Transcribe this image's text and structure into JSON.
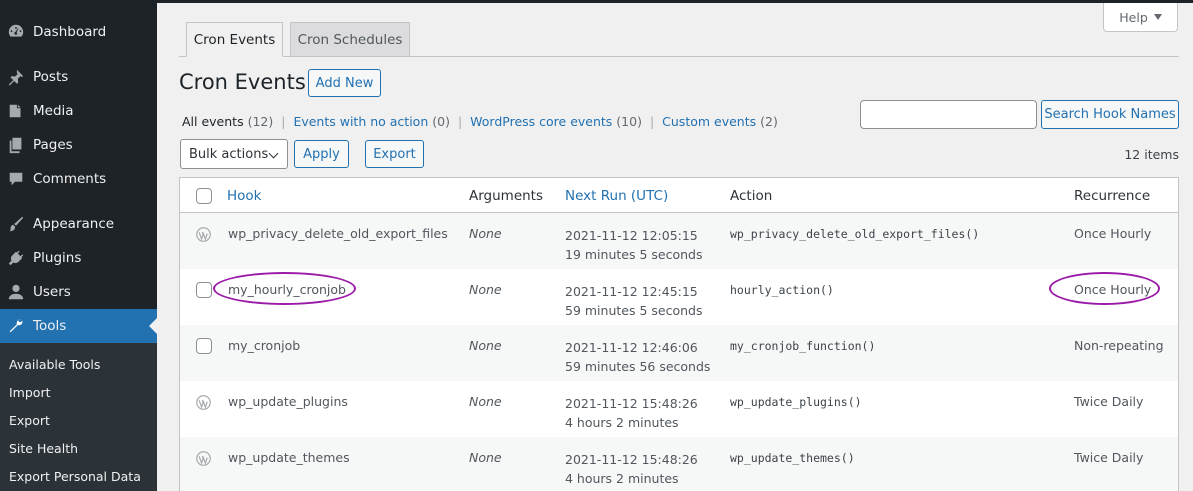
{
  "sidebar": {
    "items": [
      {
        "label": "Dashboard",
        "icon": "dashboard-icon"
      },
      {
        "label": "Posts",
        "icon": "pin-icon"
      },
      {
        "label": "Media",
        "icon": "media-icon"
      },
      {
        "label": "Pages",
        "icon": "pages-icon"
      },
      {
        "label": "Comments",
        "icon": "comment-icon"
      },
      {
        "label": "Appearance",
        "icon": "brush-icon"
      },
      {
        "label": "Plugins",
        "icon": "plug-icon"
      },
      {
        "label": "Users",
        "icon": "user-icon"
      },
      {
        "label": "Tools",
        "icon": "wrench-icon",
        "active": true
      }
    ],
    "submenu": [
      "Available Tools",
      "Import",
      "Export",
      "Site Health",
      "Export Personal Data"
    ]
  },
  "help": {
    "label": "Help"
  },
  "tabs": [
    {
      "label": "Cron Events",
      "active": true
    },
    {
      "label": "Cron Schedules",
      "active": false
    }
  ],
  "page": {
    "title": "Cron Events",
    "add_new": "Add New"
  },
  "filters": {
    "all": {
      "label": "All events",
      "count": "(12)"
    },
    "no_action": {
      "label": "Events with no action",
      "count": "(0)"
    },
    "core": {
      "label": "WordPress core events",
      "count": "(10)"
    },
    "custom": {
      "label": "Custom events",
      "count": "(2)"
    }
  },
  "search": {
    "button": "Search Hook Names",
    "value": ""
  },
  "bulk": {
    "select": "Bulk actions",
    "apply": "Apply",
    "export": "Export"
  },
  "items_count": "12 items",
  "table": {
    "headers": {
      "hook": "Hook",
      "arguments": "Arguments",
      "next_run": "Next Run (UTC)",
      "action": "Action",
      "recurrence": "Recurrence"
    },
    "rows": [
      {
        "hook": "wp_privacy_delete_old_export_files",
        "args": "None",
        "run_date": "2021-11-12 12:05:15",
        "run_rel": "19 minutes 5 seconds",
        "action": "wp_privacy_delete_old_export_files()",
        "recurrence": "Once Hourly",
        "core": true
      },
      {
        "hook": "my_hourly_cronjob",
        "args": "None",
        "run_date": "2021-11-12 12:45:15",
        "run_rel": "59 minutes 5 seconds",
        "action": "hourly_action()",
        "recurrence": "Once Hourly",
        "core": false
      },
      {
        "hook": "my_cronjob",
        "args": "None",
        "run_date": "2021-11-12 12:46:06",
        "run_rel": "59 minutes 56 seconds",
        "action": "my_cronjob_function()",
        "recurrence": "Non-repeating",
        "core": false
      },
      {
        "hook": "wp_update_plugins",
        "args": "None",
        "run_date": "2021-11-12 15:48:26",
        "run_rel": "4 hours 2 minutes",
        "action": "wp_update_plugins()",
        "recurrence": "Twice Daily",
        "core": true
      },
      {
        "hook": "wp_update_themes",
        "args": "None",
        "run_date": "2021-11-12 15:48:26",
        "run_rel": "4 hours 2 minutes",
        "action": "wp_update_themes()",
        "recurrence": "Twice Daily",
        "core": true
      }
    ]
  },
  "colors": {
    "accent": "#2271b1",
    "sidebar": "#1d2327",
    "highlight": "#9b1ba8"
  }
}
